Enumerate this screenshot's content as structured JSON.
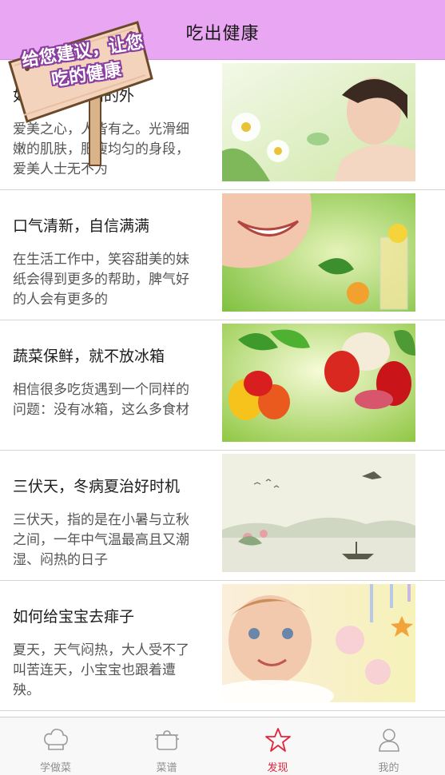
{
  "header": {
    "title": "吃出健康"
  },
  "sign": {
    "text": "给您建议，让您吃的健康"
  },
  "articles": [
    {
      "title": "如何保持美丽的外",
      "desc": "爱美之心，人皆有之。光滑细嫩的肌肤，肥瘦均匀的身段，爱美人士无不为",
      "thumb": "spa-face-image"
    },
    {
      "title": "口气清新，自信满满",
      "desc": "在生活工作中，笑容甜美的妹纸会得到更多的帮助，脾气好的人会有更多的",
      "thumb": "smile-lemon-image"
    },
    {
      "title": "蔬菜保鲜，就不放冰箱",
      "desc": "相信很多吃货遇到一个同样的问题：没有冰箱，这么多食材",
      "thumb": "vegetables-image"
    },
    {
      "title": "三伏天，冬病夏治好时机",
      "desc": "三伏天，指的是在小暑与立秋之间，一年中气温最高且又潮湿、闷热的日子",
      "thumb": "ink-landscape-image"
    },
    {
      "title": "如何给宝宝去痱子",
      "desc": "夏天，天气闷热，大人受不了叫苦连天，小宝宝也跟着遭殃。",
      "thumb": "baby-bath-image"
    }
  ],
  "tabbar": {
    "items": [
      {
        "label": "学做菜",
        "icon": "chef-hat-icon"
      },
      {
        "label": "菜谱",
        "icon": "pot-icon"
      },
      {
        "label": "发现",
        "icon": "star-icon"
      },
      {
        "label": "我的",
        "icon": "person-icon"
      }
    ],
    "active_index": 2,
    "active_color": "#e5233c"
  },
  "colors": {
    "header_bg": "#e9a6f2",
    "sign_outline": "#8a3fa0"
  }
}
